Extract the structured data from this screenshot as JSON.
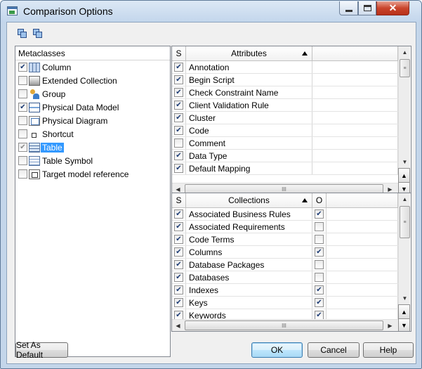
{
  "window": {
    "title": "Comparison Options"
  },
  "metaclasses": {
    "header": "Metaclasses",
    "items": [
      {
        "label": "Column",
        "checked": true,
        "icon": "column-icon"
      },
      {
        "label": "Extended Collection",
        "checked": false,
        "icon": "extended-collection-icon"
      },
      {
        "label": "Group",
        "checked": false,
        "icon": "group-icon"
      },
      {
        "label": "Physical Data Model",
        "checked": true,
        "icon": "physical-data-model-icon"
      },
      {
        "label": "Physical Diagram",
        "checked": false,
        "icon": "physical-diagram-icon"
      },
      {
        "label": "Shortcut",
        "checked": false,
        "icon": "shortcut-icon"
      },
      {
        "label": "Table",
        "checked": true,
        "icon": "table-icon",
        "selected": true,
        "grey": true
      },
      {
        "label": "Table Symbol",
        "checked": false,
        "icon": "table-symbol-icon"
      },
      {
        "label": "Target model reference",
        "checked": false,
        "icon": "target-model-reference-icon"
      }
    ]
  },
  "attributes": {
    "col_s": "S",
    "col_name": "Attributes",
    "rows": [
      {
        "name": "Annotation",
        "s": true
      },
      {
        "name": "Begin Script",
        "s": true
      },
      {
        "name": "Check Constraint Name",
        "s": true
      },
      {
        "name": "Client Validation Rule",
        "s": true
      },
      {
        "name": "Cluster",
        "s": true
      },
      {
        "name": "Code",
        "s": true
      },
      {
        "name": "Comment",
        "s": false
      },
      {
        "name": "Data Type",
        "s": true
      },
      {
        "name": "Default Mapping",
        "s": true
      }
    ]
  },
  "collections": {
    "col_s": "S",
    "col_name": "Collections",
    "col_o": "O",
    "rows": [
      {
        "name": "Associated Business Rules",
        "s": true,
        "o": true
      },
      {
        "name": "Associated Requirements",
        "s": true,
        "o": false
      },
      {
        "name": "Code Terms",
        "s": true,
        "o": false
      },
      {
        "name": "Columns",
        "s": true,
        "o": true
      },
      {
        "name": "Database Packages",
        "s": true,
        "o": false
      },
      {
        "name": "Databases",
        "s": true,
        "o": false
      },
      {
        "name": "Indexes",
        "s": true,
        "o": true
      },
      {
        "name": "Keys",
        "s": true,
        "o": true
      },
      {
        "name": "Keywords",
        "s": true,
        "o": true
      }
    ]
  },
  "buttons": {
    "set_default": "Set As Default",
    "ok": "OK",
    "cancel": "Cancel",
    "help": "Help"
  },
  "scroll_glyph": "III",
  "colors": {
    "selection": "#3399ff",
    "check": "#1b3a73"
  }
}
